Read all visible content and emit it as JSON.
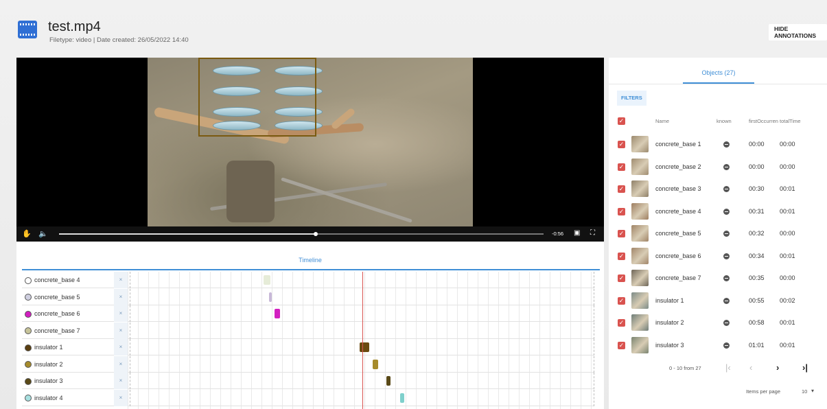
{
  "header": {
    "title": "test.mp4",
    "meta": "Filetype: video | Date created: 26/05/2022 14:40",
    "hide_annotations": "HIDE ANNOTATIONS"
  },
  "player": {
    "time_remaining": "-0:56",
    "progress": 0.53
  },
  "timeline": {
    "tab_label": "Timeline",
    "remove_symbol": "×",
    "rows": [
      {
        "label": "concrete_base 4",
        "dot": "#ffffff",
        "mark_color": "#e6ecd8"
      },
      {
        "label": "concrete_base 5",
        "dot": "#cfcfe0",
        "mark_color": "#c8b8d8"
      },
      {
        "label": "concrete_base 6",
        "dot": "#d21fc0",
        "mark_color": "#d21fc0"
      },
      {
        "label": "concrete_base 7",
        "dot": "#c7c49a",
        "mark_color": "#d8d6c0"
      },
      {
        "label": "insulator 1",
        "dot": "#5a3e10",
        "mark_color": "#6a4a10"
      },
      {
        "label": "insulator 2",
        "dot": "#a68b2c",
        "mark_color": "#a68b2c"
      },
      {
        "label": "insulator 3",
        "dot": "#5a4a18",
        "mark_color": "#5a4a18"
      },
      {
        "label": "insulator 4",
        "dot": "#a8e0e0",
        "mark_color": "#7fd0cc"
      }
    ]
  },
  "objects": {
    "tab_label": "Objects (27)",
    "filters_label": "FILTERS",
    "columns": {
      "name": "Name",
      "known": "known",
      "first": "firstOccurren",
      "total": "totalTime"
    },
    "rows": [
      {
        "name": "concrete_base 1",
        "first": "00:00",
        "total": "00:00",
        "thumb": "#9c8a6e"
      },
      {
        "name": "concrete_base 2",
        "first": "00:00",
        "total": "00:00",
        "thumb": "#a08c70"
      },
      {
        "name": "concrete_base 3",
        "first": "00:30",
        "total": "00:01",
        "thumb": "#8f8068"
      },
      {
        "name": "concrete_base 4",
        "first": "00:31",
        "total": "00:01",
        "thumb": "#9e7e60"
      },
      {
        "name": "concrete_base 5",
        "first": "00:32",
        "total": "00:00",
        "thumb": "#a08466"
      },
      {
        "name": "concrete_base 6",
        "first": "00:34",
        "total": "00:01",
        "thumb": "#a2866a"
      },
      {
        "name": "concrete_base 7",
        "first": "00:35",
        "total": "00:00",
        "thumb": "#6e6658"
      },
      {
        "name": "insulator 1",
        "first": "00:55",
        "total": "00:02",
        "thumb": "#7d8c88"
      },
      {
        "name": "insulator 2",
        "first": "00:58",
        "total": "00:01",
        "thumb": "#6f7d78"
      },
      {
        "name": "insulator 3",
        "first": "01:01",
        "total": "00:01",
        "thumb": "#7a8470"
      }
    ],
    "pager_text": "0 - 10 from 27",
    "items_per_page_label": "Items per page",
    "items_per_page_value": "10"
  }
}
